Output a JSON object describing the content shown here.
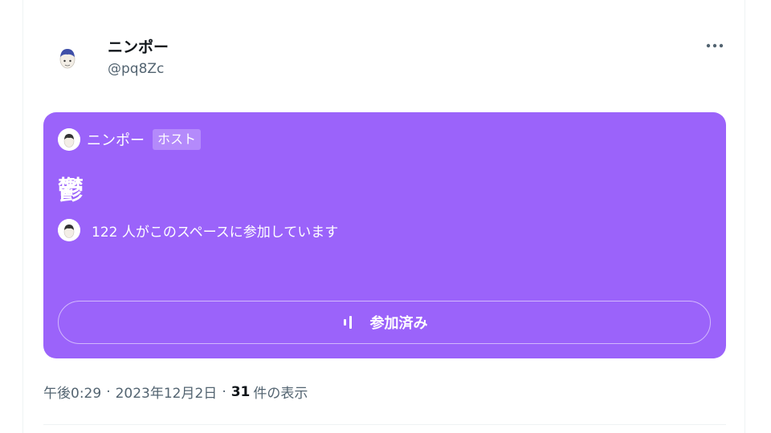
{
  "tweet": {
    "author_name": "ニンポー",
    "author_handle": "@pq8Zc"
  },
  "space": {
    "host_name": "ニンポー",
    "host_badge": "ホスト",
    "title": "鬱",
    "listeners_text": "122 人がこのスペースに参加しています",
    "joined_label": "参加済み",
    "color": "#9b63fa"
  },
  "meta": {
    "time": "午後0:29",
    "date": "2023年12月2日",
    "separator": "·",
    "views_count": "31",
    "views_label": "件の表示"
  },
  "icons": {
    "more": "more-horizontal-icon",
    "joined": "audio-bars-icon"
  }
}
